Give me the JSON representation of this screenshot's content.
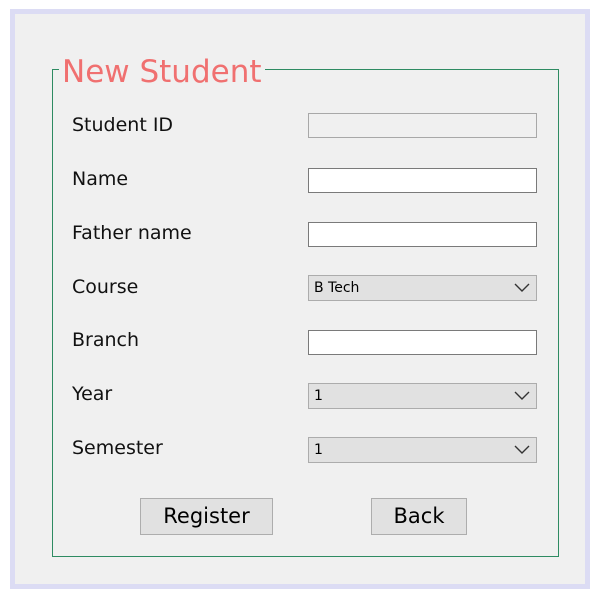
{
  "form": {
    "title": "New Student",
    "fields": {
      "student_id": {
        "label": "Student ID",
        "value": ""
      },
      "name": {
        "label": "Name",
        "value": ""
      },
      "father_name": {
        "label": "Father name",
        "value": ""
      },
      "course": {
        "label": "Course",
        "value": "B Tech"
      },
      "branch": {
        "label": "Branch",
        "value": ""
      },
      "year": {
        "label": "Year",
        "value": "1"
      },
      "semester": {
        "label": "Semester",
        "value": "1"
      }
    },
    "buttons": {
      "register": "Register",
      "back": "Back"
    }
  },
  "colors": {
    "title": "#f07070",
    "group_border": "#2e8b62",
    "window_border": "#dcdcf4",
    "background": "#f0f0f0"
  },
  "icons": {
    "dropdown": "chevron-down-icon"
  }
}
